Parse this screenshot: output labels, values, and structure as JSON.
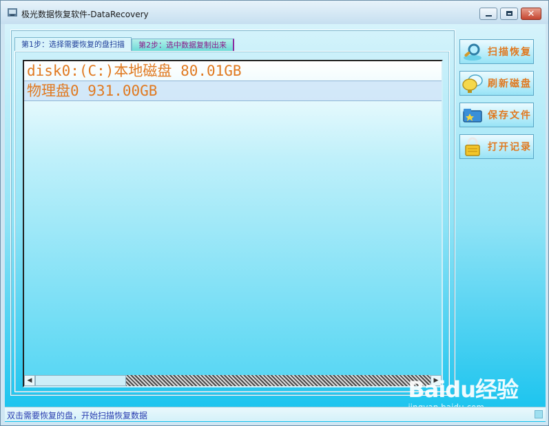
{
  "window": {
    "title": "极光数据恢复软件-DataRecovery"
  },
  "tabs": [
    {
      "label": "第1步：选择需要恢复的盘扫描"
    },
    {
      "label": "第2步：选中数据复制出来"
    }
  ],
  "disk_list": {
    "items": [
      {
        "label": "disk0:(C:)本地磁盘 80.01GB"
      },
      {
        "label": "物理盘0 931.00GB"
      }
    ]
  },
  "sidebar": {
    "scan_label": "扫描恢复",
    "refresh_label": "刷新磁盘",
    "save_label": "保存文件",
    "open_label": "打开记录"
  },
  "status": {
    "text": "双击需要恢复的盘，开始扫描恢复数据"
  },
  "watermark": {
    "logo": "Baidu经验",
    "url": "jingyan.baidu.com"
  },
  "colors": {
    "accent_text": "#e07920",
    "status_text": "#2a3db0"
  }
}
